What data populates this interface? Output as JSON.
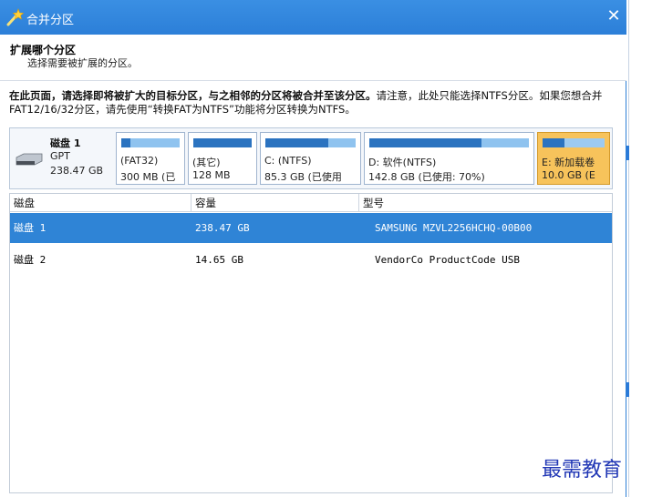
{
  "dialog": {
    "title": "合并分区",
    "close_glyph": "✕"
  },
  "header": {
    "heading": "扩展哪个分区",
    "subheading": "选择需要被扩展的分区。"
  },
  "instructions": {
    "bold_part": "在此页面，请选择即将被扩大的目标分区，与之相邻的分区将被合并至该分区。",
    "normal_part": "请注意，此处只能选择NTFS分区。如果您想合并FAT12/16/32分区，请先使用“转换FAT为NTFS”功能将分区转换为NTFS。"
  },
  "disk_map": {
    "disk_name": "磁盘 1",
    "disk_type": "GPT",
    "disk_size": "238.47 GB",
    "partitions": [
      {
        "label": "(FAT32)",
        "detail": "300 MB (已",
        "used": 0.15,
        "selected": false
      },
      {
        "label": "(其它)",
        "detail": "128 MB",
        "used": 1.0,
        "selected": false
      },
      {
        "label": "C: (NTFS)",
        "detail": "85.3 GB (已使用",
        "used": 0.7,
        "selected": false
      },
      {
        "label": "D: 软件(NTFS)",
        "detail": "142.8 GB (已使用: 70%)",
        "used": 0.7,
        "selected": false
      },
      {
        "label": "E: 新加载卷",
        "detail": "10.0 GB (E",
        "used": 0.35,
        "selected": true
      }
    ]
  },
  "table": {
    "columns": [
      "磁盘",
      "容量",
      "型号"
    ],
    "rows": [
      {
        "disk": "磁盘 1",
        "capacity": "238.47 GB",
        "model": "SAMSUNG MZVL2256HCHQ-00B00",
        "selected": true
      },
      {
        "disk": "磁盘 2",
        "capacity": "14.65 GB",
        "model": "VendorCo ProductCode USB",
        "selected": false
      }
    ]
  },
  "watermark": "最需教育",
  "colors": {
    "titlebar": "#2c7fd8",
    "selected_row": "#2f84d6",
    "selected_partition": "#f7c35b",
    "partition_used": "#2b73c0",
    "partition_free": "#8fc3ef"
  }
}
